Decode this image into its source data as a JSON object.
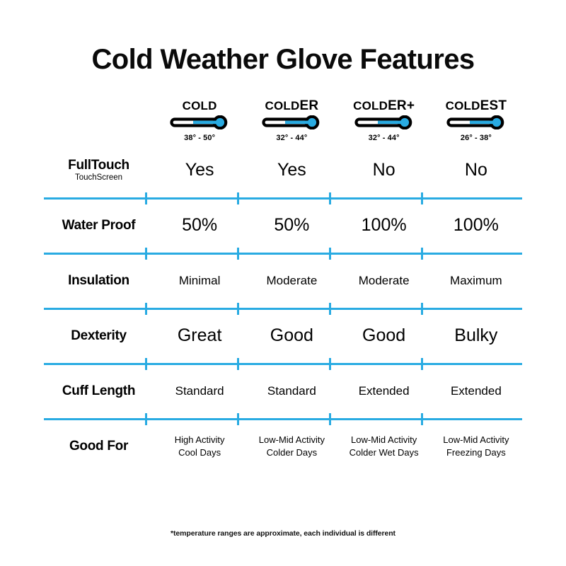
{
  "title": "Cold Weather Glove Features",
  "accent_color": "#29ABE2",
  "text_color": "#000000",
  "background_color": "#FFFFFF",
  "columns": [
    {
      "name_base": "COLD",
      "name_suffix": "",
      "full_name": "COLD",
      "range": "38° - 50°",
      "icon": "thermometer-icon",
      "fill_percent": 45
    },
    {
      "name_base": "COLD",
      "name_suffix": "ER",
      "full_name": "COLDER",
      "range": "32° - 44°",
      "icon": "thermometer-icon",
      "fill_percent": 45
    },
    {
      "name_base": "COLD",
      "name_suffix": "ER+",
      "full_name": "COLDER+",
      "range": "32° - 44°",
      "icon": "thermometer-icon",
      "fill_percent": 45
    },
    {
      "name_base": "COLD",
      "name_suffix": "EST",
      "full_name": "COLDEST",
      "range": "26° - 38°",
      "icon": "thermometer-icon",
      "fill_percent": 45
    }
  ],
  "rows": [
    {
      "label": "FullTouch",
      "sublabel": "TouchScreen",
      "size": "lg",
      "values": [
        "Yes",
        "Yes",
        "No",
        "No"
      ]
    },
    {
      "label": "Water Proof",
      "sublabel": "",
      "size": "lg",
      "values": [
        "50%",
        "50%",
        "100%",
        "100%"
      ]
    },
    {
      "label": "Insulation",
      "sublabel": "",
      "size": "md",
      "values": [
        "Minimal",
        "Moderate",
        "Moderate",
        "Maximum"
      ]
    },
    {
      "label": "Dexterity",
      "sublabel": "",
      "size": "lg",
      "values": [
        "Great",
        "Good",
        "Good",
        "Bulky"
      ]
    },
    {
      "label": "Cuff Length",
      "sublabel": "",
      "size": "md",
      "values": [
        "Standard",
        "Standard",
        "Extended",
        "Extended"
      ]
    },
    {
      "label": "Good For",
      "sublabel": "",
      "size": "sm",
      "values": [
        "High Activity\nCool Days",
        "Low-Mid Activity\nColder Days",
        "Low-Mid Activity\nColder Wet Days",
        "Low-Mid Activity\nFreezing Days"
      ]
    }
  ],
  "footnote": "*temperature ranges are approximate, each individual is different"
}
